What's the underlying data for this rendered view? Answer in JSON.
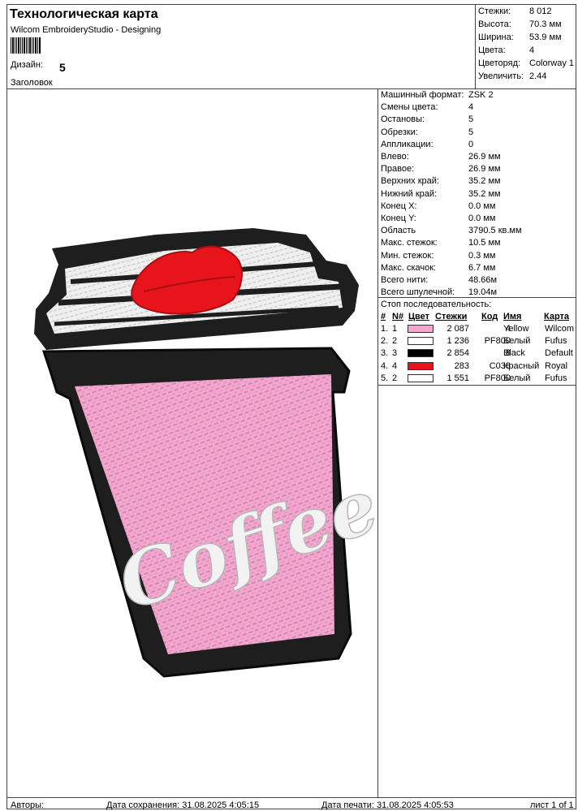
{
  "header": {
    "title": "Технологическая карта",
    "subtitle": "Wilcom EmbroideryStudio - Designing",
    "design_label": "Дизайн:",
    "design_value": "5",
    "heading_label": "Заголовок"
  },
  "summary": [
    {
      "label": "Стежки:",
      "value": "8 012"
    },
    {
      "label": "Высота:",
      "value": "70.3 мм"
    },
    {
      "label": "Ширина:",
      "value": "53.9 мм"
    },
    {
      "label": "Цвета:",
      "value": "4"
    },
    {
      "label": "Цветоряд:",
      "value": "Colorway 1"
    },
    {
      "label": "Увеличить:",
      "value": "2.44"
    }
  ],
  "details": [
    {
      "label": "Машинный формат:",
      "value": "ZSK 2"
    },
    {
      "label": "Смены цвета:",
      "value": "4"
    },
    {
      "label": "Остановы:",
      "value": "5"
    },
    {
      "label": "Обрезки:",
      "value": "5"
    },
    {
      "label": "Аппликации:",
      "value": "0"
    },
    {
      "label": "Влево:",
      "value": "26.9 мм"
    },
    {
      "label": "Правое:",
      "value": "26.9 мм"
    },
    {
      "label": "Верхних край:",
      "value": "35.2 мм"
    },
    {
      "label": "Нижний край:",
      "value": "35.2 мм"
    },
    {
      "label": "Конец X:",
      "value": "0.0 мм"
    },
    {
      "label": "Конец Y:",
      "value": "0.0 мм"
    },
    {
      "label": "Область",
      "value": "3790.5 кв.мм"
    },
    {
      "label": "Макс. стежок:",
      "value": "10.5 мм"
    },
    {
      "label": "Мин. стежок:",
      "value": "0.3 мм"
    },
    {
      "label": "Макс. скачок:",
      "value": "6.7 мм"
    },
    {
      "label": "Всего нити:",
      "value": "48.66м"
    },
    {
      "label": "Всего шпулечной:",
      "value": "19.04м"
    }
  ],
  "sequence_title": "Стоп последовательность:",
  "sequence_columns": {
    "num": "#",
    "n": "N#",
    "color": "Цвет",
    "stitches": "Стежки",
    "code": "Код",
    "name": "Имя",
    "chart": "Карта"
  },
  "sequence": [
    {
      "num": "1.",
      "n": "1",
      "color": "#f4a6cf",
      "stitches": "2 087",
      "code": "4",
      "name": "Yellow",
      "chart": "Wilcom"
    },
    {
      "num": "2.",
      "n": "2",
      "color": "#ffffff",
      "stitches": "1 236",
      "code": "PF800",
      "name": "Белый",
      "chart": "Fufus"
    },
    {
      "num": "3.",
      "n": "3",
      "color": "#000000",
      "stitches": "2 854",
      "code": "8",
      "name": "Black",
      "chart": "Default"
    },
    {
      "num": "4.",
      "n": "4",
      "color": "#e8141c",
      "stitches": "283",
      "code": "C038",
      "name": "Красный",
      "chart": "Royal"
    },
    {
      "num": "5.",
      "n": "2",
      "color": "#ffffff",
      "stitches": "1 551",
      "code": "PF800",
      "name": "Белый",
      "chart": "Fufus"
    }
  ],
  "footer": {
    "authors": "Авторы:",
    "saved": "Дата сохранения: 31.08.2025 4:05:15",
    "printed": "Дата печати: 31.08.2025 4:05:53",
    "page": "лист 1 of 1"
  },
  "design_text": "Coffee",
  "colors": {
    "pink": "#f4a6cf",
    "red": "#e8141c",
    "black": "#1a1a1a",
    "white": "#f2f2f2"
  }
}
